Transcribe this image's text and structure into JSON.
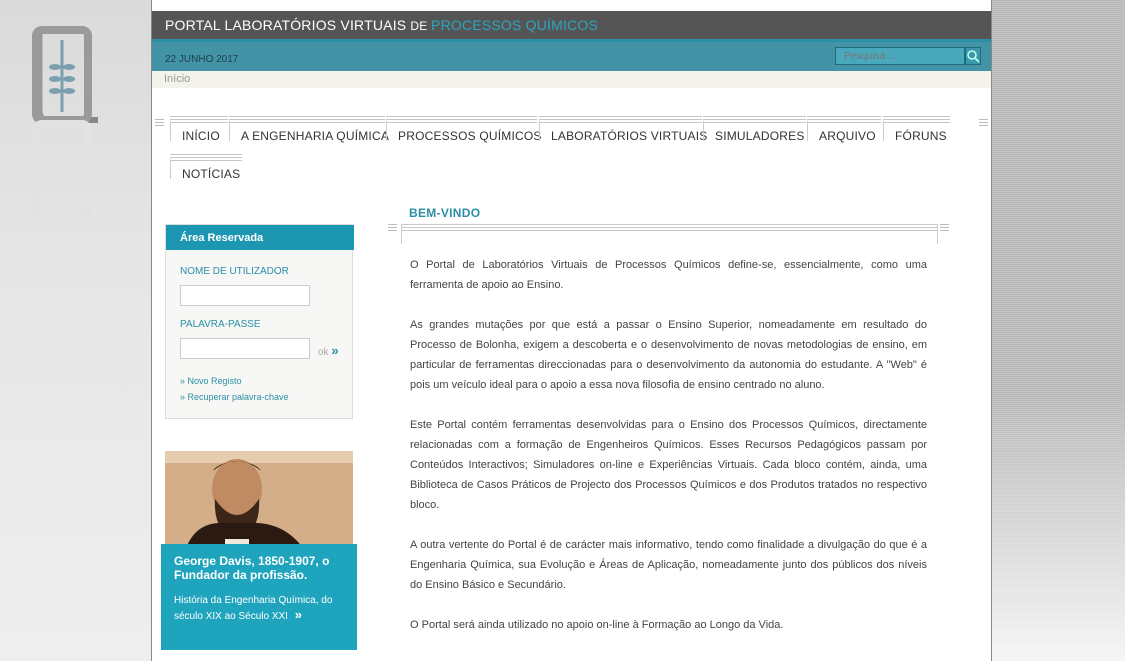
{
  "comment_fragment": "-->",
  "site": {
    "title_part1": "PORTAL LABORATÓRIOS VIRTUAIS ",
    "title_part2": "DE ",
    "title_part3": "PROCESSOS QUÍMICOS",
    "date": "22 JUNHO 2017",
    "search_placeholder": "Pesquisa ...",
    "breadcrumb": "Início",
    "accent_color": "#2ba6c0"
  },
  "menu": {
    "items": [
      {
        "label": "INÍCIO"
      },
      {
        "label": "A ENGENHARIA QUÍMICA"
      },
      {
        "label": "PROCESSOS QUÍMICOS"
      },
      {
        "label": "LABORATÓRIOS VIRTUAIS"
      },
      {
        "label": "SIMULADORES"
      },
      {
        "label": "ARQUIVO"
      },
      {
        "label": "FÓRUNS"
      },
      {
        "label": "NOTÍCIAS"
      }
    ]
  },
  "login": {
    "heading": "Área Reservada",
    "username_label": "NOME DE UTILIZADOR",
    "password_label": "PALAVRA-PASSE",
    "ok_label": "ok",
    "ok_arrow": "»",
    "register_link": "» Novo Registo",
    "recover_link": "» Recuperar palavra-chave"
  },
  "promo": {
    "title": "George Davis, 1850-1907, o Fundador da profissão.",
    "subtitle": "História da Engenharia Química, do século XIX ao Século XXI",
    "arrow": "»"
  },
  "content": {
    "title": "BEM-VINDO",
    "paragraphs": [
      "O Portal de Laboratórios Virtuais de Processos Químicos define-se, essencialmente, como uma ferramenta de apoio ao Ensino.",
      "As grandes mutações por que está a passar o Ensino Superior, nomeadamente em resultado do Processo de Bolonha, exigem a descoberta e o desenvolvimento de novas metodologias de ensino, em particular de ferramentas direccionadas para o desenvolvimento da autonomia do estudante. A \"Web\" é pois um veículo ideal para o apoio a essa nova filosofia de ensino centrado no aluno.",
      "Este Portal contém ferramentas desenvolvidas para o Ensino dos Processos Químicos, directamente relacionadas com a formação de Engenheiros Químicos. Esses Recursos Pedagógicos passam por Conteúdos Interactivos; Simuladores on-line e Experiências Virtuais. Cada bloco contém, ainda, uma Biblioteca de Casos Práticos de Projecto dos Processos Químicos e dos Produtos tratados no respectivo bloco.",
      "A outra vertente do Portal é de carácter mais informativo, tendo como finalidade a divulgação do que é a Engenharia Química, sua Evolução e Áreas de Aplicação, nomeadamente junto dos públicos dos níveis do Ensino Básico e Secundário.",
      "O Portal será ainda utilizado no apoio on-line à Formação ao Longo da Vida."
    ]
  }
}
